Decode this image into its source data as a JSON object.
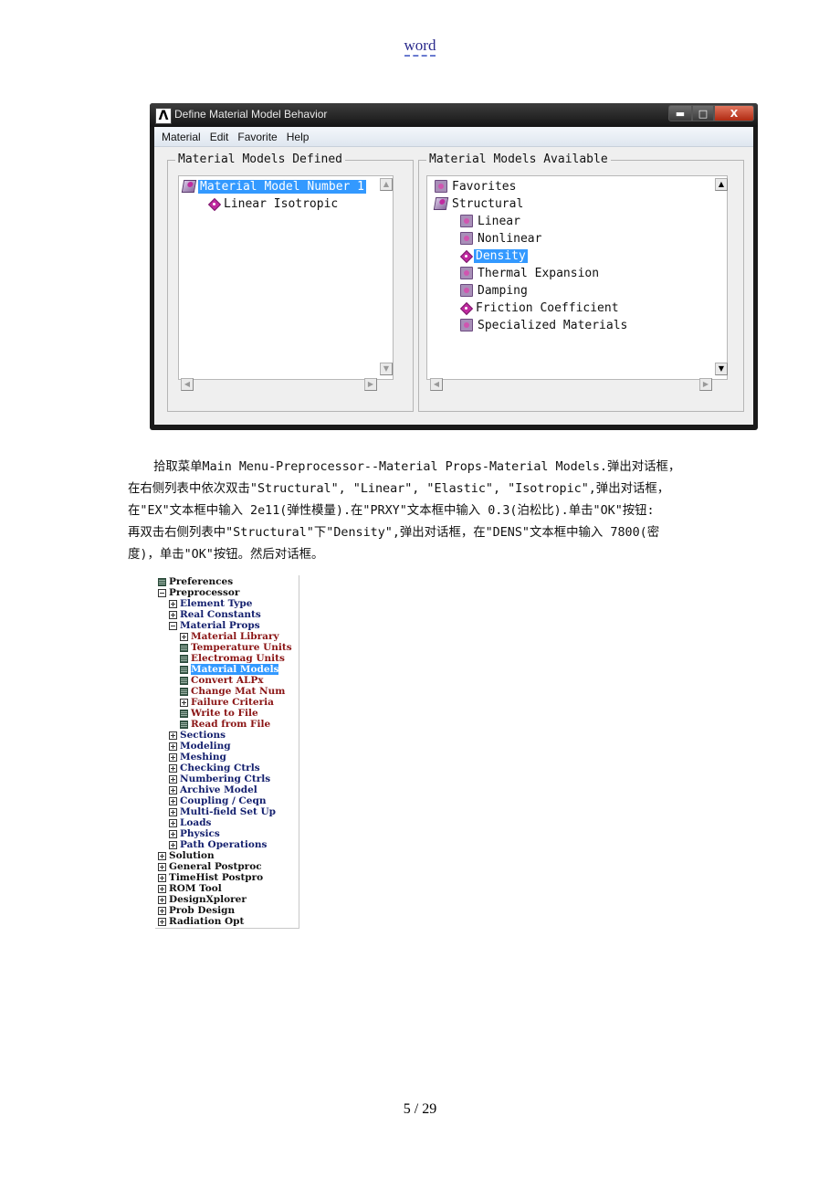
{
  "header": {
    "text": "word"
  },
  "footer": {
    "page": "5 / 29"
  },
  "dialog": {
    "title": "Define Material Model Behavior",
    "window_buttons": {
      "minimize": "▬",
      "maximize": "□",
      "close": "X"
    },
    "menu": [
      "Material",
      "Edit",
      "Favorite",
      "Help"
    ],
    "left_group": {
      "title": "Material Models Defined",
      "items": [
        {
          "label": "Material Model Number 1",
          "icon": "open-folder-icon",
          "selected": true,
          "level": 0
        },
        {
          "label": "Linear Isotropic",
          "icon": "material-property-icon",
          "selected": false,
          "level": 1
        }
      ]
    },
    "right_group": {
      "title": "Material Models Available",
      "items": [
        {
          "label": "Favorites",
          "icon": "folder-icon",
          "selected": false,
          "level": 0
        },
        {
          "label": "Structural",
          "icon": "open-folder-icon",
          "selected": false,
          "level": 0
        },
        {
          "label": "Linear",
          "icon": "folder-icon",
          "selected": false,
          "level": 1
        },
        {
          "label": "Nonlinear",
          "icon": "folder-icon",
          "selected": false,
          "level": 1
        },
        {
          "label": "Density",
          "icon": "material-property-icon",
          "selected": true,
          "level": 1
        },
        {
          "label": "Thermal Expansion",
          "icon": "folder-icon",
          "selected": false,
          "level": 1
        },
        {
          "label": "Damping",
          "icon": "folder-icon",
          "selected": false,
          "level": 1
        },
        {
          "label": "Friction Coefficient",
          "icon": "material-property-icon",
          "selected": false,
          "level": 1
        },
        {
          "label": "Specialized Materials",
          "icon": "folder-icon",
          "selected": false,
          "level": 1
        }
      ]
    },
    "scroll_glyphs": {
      "up": "▲",
      "down": "▼",
      "left": "◀",
      "right": "▶"
    }
  },
  "paragraph": [
    "拾取菜单Main Menu-Preprocessor--Material Props-Material Models.弹出对话框，",
    "在右侧列表中依次双击\"Structural\", \"Linear\", \"Elastic\", \"Isotropic\",弹出对话框，",
    "在\"EX\"文本框中输入 2e11(弹性模量).在\"PRXY\"文本框中输入 0.3(泊松比).单击\"OK\"按钮:",
    "再双击右侧列表中\"Structural\"下\"Density\",弹出对话框，在\"DENS\"文本框中输入 7800(密",
    "度)，单击\"OK\"按钮。然后对话框。"
  ],
  "main_menu_tree": [
    {
      "label": "Preferences",
      "icon": "leaf",
      "level": 0,
      "color": "black"
    },
    {
      "label": "Preprocessor",
      "icon": "minus",
      "level": 0,
      "color": "black"
    },
    {
      "label": "Element Type",
      "icon": "plus",
      "level": 1,
      "color": "blue"
    },
    {
      "label": "Real Constants",
      "icon": "plus",
      "level": 1,
      "color": "blue"
    },
    {
      "label": "Material Props",
      "icon": "minus",
      "level": 1,
      "color": "blue"
    },
    {
      "label": "Material Library",
      "icon": "plus",
      "level": 2,
      "color": "red"
    },
    {
      "label": "Temperature Units",
      "icon": "leaf",
      "level": 2,
      "color": "red"
    },
    {
      "label": "Electromag Units",
      "icon": "leaf",
      "level": 2,
      "color": "red"
    },
    {
      "label": "Material Models",
      "icon": "leaf",
      "level": 2,
      "color": "red",
      "selected": true
    },
    {
      "label": "Convert ALPx",
      "icon": "leaf",
      "level": 2,
      "color": "red"
    },
    {
      "label": "Change Mat Num",
      "icon": "leaf",
      "level": 2,
      "color": "red"
    },
    {
      "label": "Failure Criteria",
      "icon": "plus",
      "level": 2,
      "color": "red"
    },
    {
      "label": "Write to File",
      "icon": "leaf",
      "level": 2,
      "color": "red"
    },
    {
      "label": "Read from File",
      "icon": "leaf",
      "level": 2,
      "color": "red"
    },
    {
      "label": "Sections",
      "icon": "plus",
      "level": 1,
      "color": "blue"
    },
    {
      "label": "Modeling",
      "icon": "plus",
      "level": 1,
      "color": "blue"
    },
    {
      "label": "Meshing",
      "icon": "plus",
      "level": 1,
      "color": "blue"
    },
    {
      "label": "Checking Ctrls",
      "icon": "plus",
      "level": 1,
      "color": "blue"
    },
    {
      "label": "Numbering Ctrls",
      "icon": "plus",
      "level": 1,
      "color": "blue"
    },
    {
      "label": "Archive Model",
      "icon": "plus",
      "level": 1,
      "color": "blue"
    },
    {
      "label": "Coupling / Ceqn",
      "icon": "plus",
      "level": 1,
      "color": "blue"
    },
    {
      "label": "Multi-field Set Up",
      "icon": "plus",
      "level": 1,
      "color": "blue"
    },
    {
      "label": "Loads",
      "icon": "plus",
      "level": 1,
      "color": "blue"
    },
    {
      "label": "Physics",
      "icon": "plus",
      "level": 1,
      "color": "blue"
    },
    {
      "label": "Path Operations",
      "icon": "plus",
      "level": 1,
      "color": "blue"
    },
    {
      "label": "Solution",
      "icon": "plus",
      "level": 0,
      "color": "black"
    },
    {
      "label": "General Postproc",
      "icon": "plus",
      "level": 0,
      "color": "black"
    },
    {
      "label": "TimeHist Postpro",
      "icon": "plus",
      "level": 0,
      "color": "black"
    },
    {
      "label": "ROM Tool",
      "icon": "plus",
      "level": 0,
      "color": "black"
    },
    {
      "label": "DesignXplorer",
      "icon": "plus",
      "level": 0,
      "color": "black"
    },
    {
      "label": "Prob Design",
      "icon": "plus",
      "level": 0,
      "color": "black"
    },
    {
      "label": "Radiation Opt",
      "icon": "plus",
      "level": 0,
      "color": "black"
    }
  ]
}
